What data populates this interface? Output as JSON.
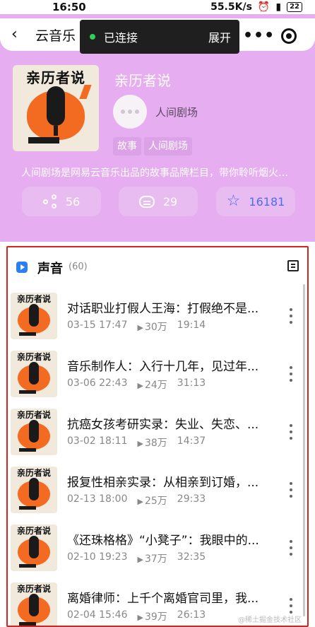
{
  "status_bar": {
    "time": "16:50",
    "speed": "55.5K/s",
    "battery": "22"
  },
  "nav": {
    "title": "云音乐",
    "connection": "已连接",
    "expand": "展开"
  },
  "podcast": {
    "cover_title": "亲历者说",
    "title": "亲历者说",
    "author": "人间剧场",
    "tags": [
      "故事",
      "人间剧场"
    ],
    "description": "人间剧场是网易云音乐出品的故事品牌栏目，带你聆听烟火人...",
    "stats": {
      "shares": "56",
      "comments": "29",
      "stars": "16181"
    }
  },
  "list": {
    "section_title": "声音",
    "count": "(60)",
    "episodes": [
      {
        "thumb_title": "亲历者说",
        "title": "对话职业打假人王海：打假绝不是...",
        "date": "03-15 17:47",
        "plays": "30万",
        "duration": "19:14"
      },
      {
        "thumb_title": "亲历者说",
        "title": "音乐制作人：入行十几年，见过年...",
        "date": "03-06 22:43",
        "plays": "24万",
        "duration": "31:13"
      },
      {
        "thumb_title": "亲历者说",
        "title": "抗癌女孩考研实录：失业、失恋、...",
        "date": "03-02 18:11",
        "plays": "38万",
        "duration": "14:37"
      },
      {
        "thumb_title": "亲历者说",
        "title": "报复性相亲实录：从相亲到订婚，...",
        "date": "02-13 18:00",
        "plays": "25万",
        "duration": "29:33"
      },
      {
        "thumb_title": "亲历者说",
        "title": "《还珠格格》“小凳子”：我眼中的...",
        "date": "02-10 19:23",
        "plays": "37万",
        "duration": "32:35"
      },
      {
        "thumb_title": "亲历者说",
        "title": "离婚律师：上千个离婚官司里，我...",
        "date": "02-04 15:46",
        "plays": "39万",
        "duration": "26:13"
      }
    ]
  },
  "watermark": "@稀土掘金技术社区"
}
